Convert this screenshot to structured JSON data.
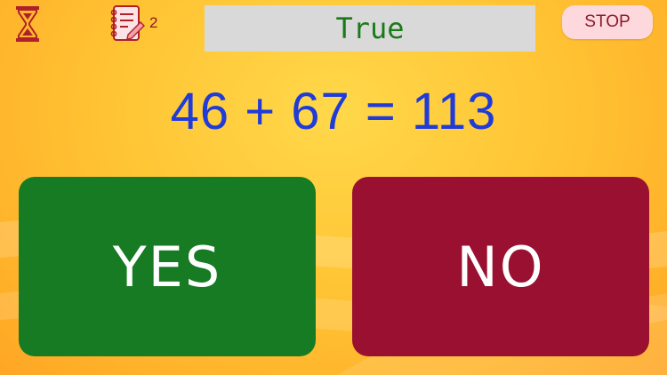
{
  "header": {
    "timer_icon": "hourglass-icon",
    "notes_icon": "notebook-icon",
    "notes_count": "2",
    "feedback": "True",
    "stop_label": "STOP"
  },
  "question": {
    "equation": "46 + 67 = 113"
  },
  "answers": {
    "yes_label": "YES",
    "no_label": "NO"
  },
  "colors": {
    "background": "#ffc535",
    "feedback_text": "#1a7a1a",
    "equation_text": "#1f3bd8",
    "yes": "#167b22",
    "no": "#9a1030",
    "stop_bg": "#fdd8dd",
    "stop_text": "#8a1a2a"
  }
}
